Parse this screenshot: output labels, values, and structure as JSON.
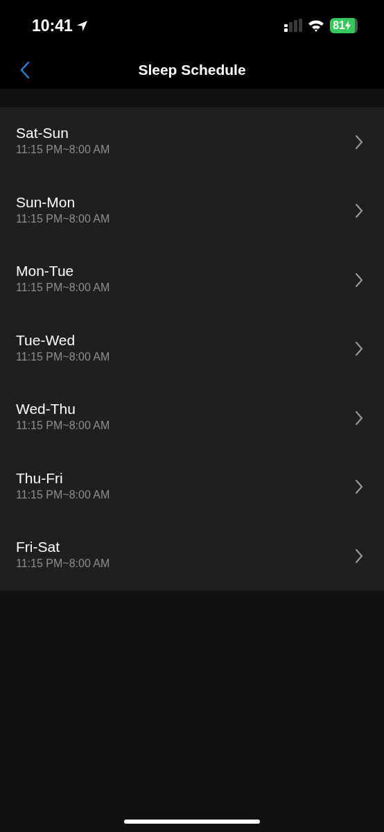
{
  "status_bar": {
    "time": "10:41",
    "battery": "81"
  },
  "nav_bar": {
    "title": "Sleep Schedule"
  },
  "schedules": [
    {
      "days": "Sat-Sun",
      "time": "11:15 PM~8:00 AM"
    },
    {
      "days": "Sun-Mon",
      "time": "11:15 PM~8:00 AM"
    },
    {
      "days": "Mon-Tue",
      "time": "11:15 PM~8:00 AM"
    },
    {
      "days": "Tue-Wed",
      "time": "11:15 PM~8:00 AM"
    },
    {
      "days": "Wed-Thu",
      "time": "11:15 PM~8:00 AM"
    },
    {
      "days": "Thu-Fri",
      "time": "11:15 PM~8:00 AM"
    },
    {
      "days": "Fri-Sat",
      "time": "11:15 PM~8:00 AM"
    }
  ]
}
